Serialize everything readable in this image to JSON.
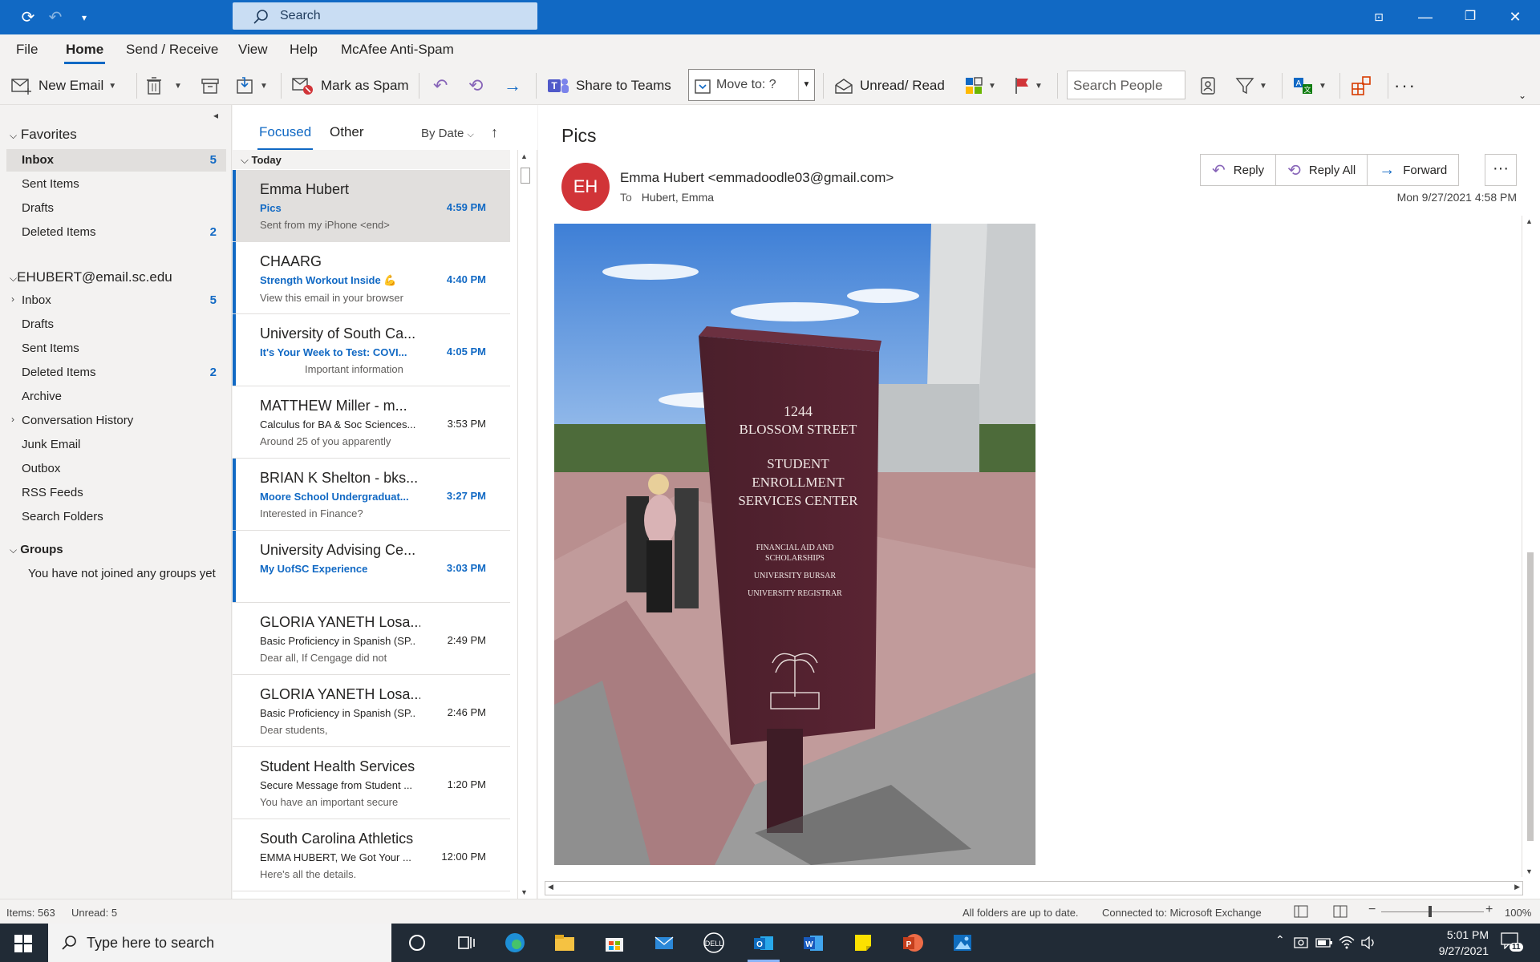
{
  "titlebar": {
    "search_placeholder": "Search"
  },
  "menu": {
    "tabs": [
      "File",
      "Home",
      "Send / Receive",
      "View",
      "Help",
      "McAfee Anti-Spam"
    ]
  },
  "ribbon": {
    "new_email": "New Email",
    "mark_as_spam": "Mark as Spam",
    "share_to_teams": "Share to Teams",
    "move_to": "Move to: ?",
    "unread_read": "Unread/ Read",
    "search_people": "Search People"
  },
  "folders": {
    "favorites_header": "Favorites",
    "favorites": [
      {
        "name": "Inbox",
        "count": "5"
      },
      {
        "name": "Sent Items",
        "count": ""
      },
      {
        "name": "Drafts",
        "count": ""
      },
      {
        "name": "Deleted Items",
        "count": "2"
      }
    ],
    "account_header": "EHUBERT@email.sc.edu",
    "account": [
      {
        "name": "Inbox",
        "count": "5"
      },
      {
        "name": "Drafts",
        "count": ""
      },
      {
        "name": "Sent Items",
        "count": ""
      },
      {
        "name": "Deleted Items",
        "count": "2"
      },
      {
        "name": "Archive",
        "count": ""
      },
      {
        "name": "Conversation History",
        "count": ""
      },
      {
        "name": "Junk Email",
        "count": ""
      },
      {
        "name": "Outbox",
        "count": ""
      },
      {
        "name": "RSS Feeds",
        "count": ""
      },
      {
        "name": "Search Folders",
        "count": ""
      }
    ],
    "groups_header": "Groups",
    "groups_empty": "You have not joined any groups yet"
  },
  "list": {
    "tab_focused": "Focused",
    "tab_other": "Other",
    "sort": "By Date",
    "group_today": "Today",
    "messages": [
      {
        "from": "Emma Hubert",
        "subject": "Pics",
        "preview": "Sent from my iPhone <end>",
        "time": "4:59 PM"
      },
      {
        "from": "CHAARG",
        "subject": "Strength Workout Inside 💪",
        "preview": "View this email in your browser",
        "time": "4:40 PM"
      },
      {
        "from": "University of South Ca...",
        "subject": "It's Your Week to Test: COVI...",
        "preview": "Important information",
        "time": "4:05 PM"
      },
      {
        "from": "MATTHEW Miller - m...",
        "subject": "Calculus for BA & Soc Sciences...",
        "preview": "Around 25 of you apparently",
        "time": "3:53 PM"
      },
      {
        "from": "BRIAN K Shelton - bks...",
        "subject": "Moore School Undergraduat...",
        "preview": "Interested in Finance?",
        "time": "3:27 PM"
      },
      {
        "from": "University Advising Ce...",
        "subject": "My UofSC Experience",
        "preview": "",
        "time": "3:03 PM"
      },
      {
        "from": "GLORIA YANETH Losa...",
        "subject": "Basic Proficiency in Spanish (SP...",
        "preview": "Dear all,  If Cengage did not",
        "time": "2:49 PM"
      },
      {
        "from": "GLORIA YANETH Losa...",
        "subject": "Basic Proficiency in Spanish (SP...",
        "preview": "Dear students,",
        "time": "2:46 PM"
      },
      {
        "from": "Student Health Services",
        "subject": "Secure Message from Student ...",
        "preview": "You have an important secure",
        "time": "1:20 PM"
      },
      {
        "from": "South Carolina Athletics",
        "subject": "EMMA HUBERT, We Got Your ...",
        "preview": "Here's all the details.",
        "time": "12:00 PM"
      }
    ]
  },
  "reading": {
    "subject": "Pics",
    "initials": "EH",
    "from": "Emma Hubert <emmadoodle03@gmail.com>",
    "to_label": "To",
    "to": "Hubert, Emma",
    "reply": "Reply",
    "reply_all": "Reply All",
    "forward": "Forward",
    "date": "Mon 9/27/2021 4:58 PM",
    "sign": {
      "line1": "1244",
      "line2": "BLOSSOM STREET",
      "line3": "STUDENT",
      "line4": "ENROLLMENT",
      "line5": "SERVICES CENTER",
      "line6": "FINANCIAL AID AND",
      "line7": "SCHOLARSHIPS",
      "line8": "UNIVERSITY BURSAR",
      "line9": "UNIVERSITY REGISTRAR"
    }
  },
  "status": {
    "items": "Items: 563",
    "unread": "Unread: 5",
    "sync": "All folders are up to date.",
    "connected": "Connected to: Microsoft Exchange",
    "zoom": "100%"
  },
  "taskbar": {
    "search_placeholder": "Type here to search",
    "time": "5:01 PM",
    "date": "9/27/2021",
    "notifications": "11"
  }
}
